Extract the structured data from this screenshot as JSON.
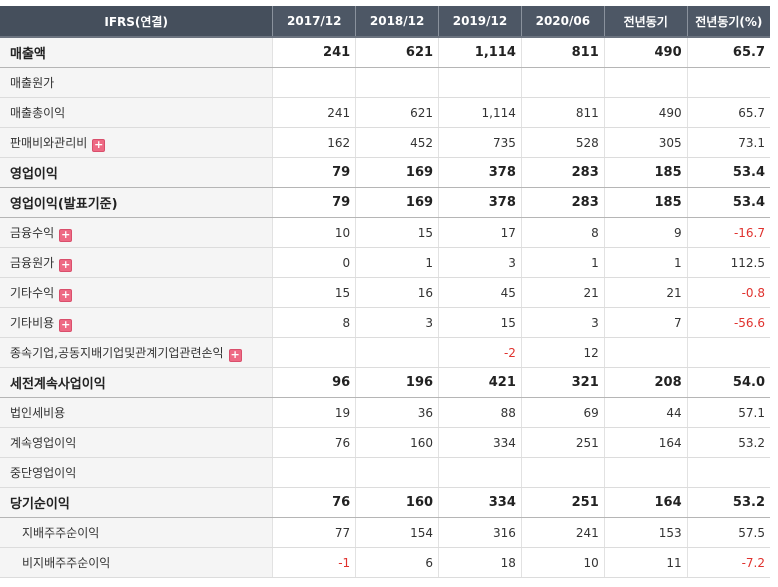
{
  "table": {
    "headers": [
      "IFRS(연결)",
      "2017/12",
      "2018/12",
      "2019/12",
      "2020/06",
      "전년동기",
      "전년동기(%)"
    ],
    "rows": [
      {
        "label": "매출액",
        "values": [
          "241",
          "621",
          "1,114",
          "811",
          "490",
          "65.7"
        ],
        "bold": true,
        "expand": false
      },
      {
        "label": "매출원가",
        "values": [
          "",
          "",
          "",
          "",
          "",
          ""
        ],
        "bold": false,
        "expand": false
      },
      {
        "label": "매출총이익",
        "values": [
          "241",
          "621",
          "1,114",
          "811",
          "490",
          "65.7"
        ],
        "bold": false,
        "expand": false
      },
      {
        "label": "판매비와관리비",
        "values": [
          "162",
          "452",
          "735",
          "528",
          "305",
          "73.1"
        ],
        "bold": false,
        "expand": true
      },
      {
        "label": "영업이익",
        "values": [
          "79",
          "169",
          "378",
          "283",
          "185",
          "53.4"
        ],
        "bold": true,
        "expand": false
      },
      {
        "label": "영업이익(발표기준)",
        "values": [
          "79",
          "169",
          "378",
          "283",
          "185",
          "53.4"
        ],
        "bold": true,
        "expand": false
      },
      {
        "label": "금융수익",
        "values": [
          "10",
          "15",
          "17",
          "8",
          "9",
          "-16.7"
        ],
        "bold": false,
        "expand": true
      },
      {
        "label": "금융원가",
        "values": [
          "0",
          "1",
          "3",
          "1",
          "1",
          "112.5"
        ],
        "bold": false,
        "expand": true
      },
      {
        "label": "기타수익",
        "values": [
          "15",
          "16",
          "45",
          "21",
          "21",
          "-0.8"
        ],
        "bold": false,
        "expand": true
      },
      {
        "label": "기타비용",
        "values": [
          "8",
          "3",
          "15",
          "3",
          "7",
          "-56.6"
        ],
        "bold": false,
        "expand": true
      },
      {
        "label": "종속기업,공동지배기업및관계기업관련손익",
        "values": [
          "",
          "",
          "-2",
          "12",
          "",
          ""
        ],
        "bold": false,
        "expand": true
      },
      {
        "label": "세전계속사업이익",
        "values": [
          "96",
          "196",
          "421",
          "321",
          "208",
          "54.0"
        ],
        "bold": true,
        "expand": false
      },
      {
        "label": "법인세비용",
        "values": [
          "19",
          "36",
          "88",
          "69",
          "44",
          "57.1"
        ],
        "bold": false,
        "expand": false
      },
      {
        "label": "계속영업이익",
        "values": [
          "76",
          "160",
          "334",
          "251",
          "164",
          "53.2"
        ],
        "bold": false,
        "expand": false
      },
      {
        "label": "중단영업이익",
        "values": [
          "",
          "",
          "",
          "",
          "",
          ""
        ],
        "bold": false,
        "expand": false
      },
      {
        "label": "당기순이익",
        "values": [
          "76",
          "160",
          "334",
          "251",
          "164",
          "53.2"
        ],
        "bold": true,
        "expand": false
      },
      {
        "label": "지배주주순이익",
        "values": [
          "77",
          "154",
          "316",
          "241",
          "153",
          "57.5"
        ],
        "bold": false,
        "expand": false,
        "sub": true
      },
      {
        "label": "비지배주주순이익",
        "values": [
          "-1",
          "6",
          "18",
          "10",
          "11",
          "-7.2"
        ],
        "bold": false,
        "expand": false,
        "sub": true
      }
    ],
    "expand_icon": "plus-icon",
    "colors": {
      "header_bg": "#4d5765",
      "negative": "#e0322e",
      "label_bg": "#f5f5f5",
      "expand_icon": "#ee6a84"
    }
  }
}
